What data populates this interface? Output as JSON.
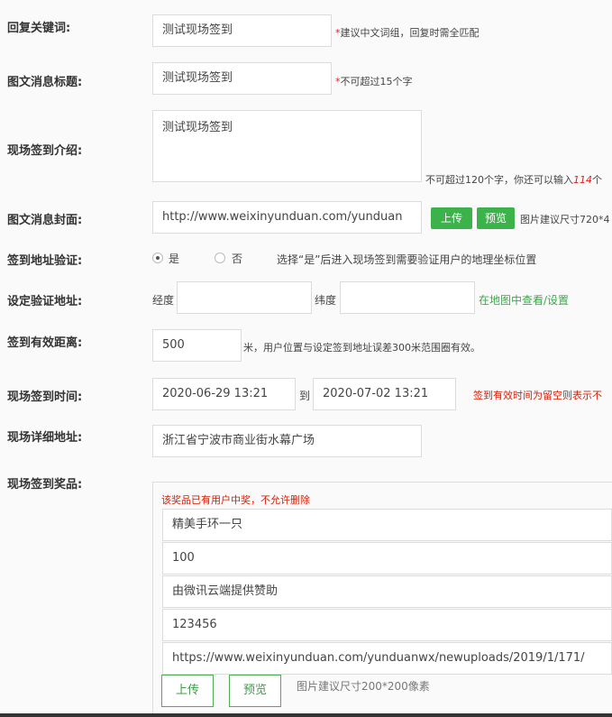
{
  "keyword": {
    "label": "回复关键词:",
    "value": "测试现场签到",
    "req": "*",
    "hint": "建议中文词组，回复时需全匹配"
  },
  "title": {
    "label": "图文消息标题:",
    "value": "测试现场签到",
    "req": "*",
    "hint": "不可超过15个字"
  },
  "intro": {
    "label": "现场签到介绍:",
    "value": "测试现场签到",
    "hint_prefix": "不可超过120个字，你还可以输入",
    "remaining": "114",
    "hint_suffix": "个"
  },
  "cover": {
    "label": "图文消息封面:",
    "value": "http://www.weixinyunduan.com/yunduan",
    "upload": "上传",
    "preview": "预览",
    "hint": "图片建议尺寸720*4"
  },
  "verify": {
    "label": "签到地址验证:",
    "yes": "是",
    "no": "否",
    "hint": "选择“是”后进入现场签到需要验证用户的地理坐标位置"
  },
  "location": {
    "label": "设定验证地址:",
    "lng_label": "经度",
    "lat_label": "纬度",
    "lng": "",
    "lat": "",
    "map_link": "在地图中查看/设置"
  },
  "distance": {
    "label": "签到有效距离:",
    "value": "500",
    "hint": "米，用户位置与设定签到地址误差300米范围圈有效。"
  },
  "time": {
    "label": "现场签到时间:",
    "start": "2020-06-29 13:21",
    "to": "到",
    "end": "2020-07-02 13:21",
    "hint": "签到有效时间为留空则表示不"
  },
  "address": {
    "label": "现场详细地址:",
    "value": "浙江省宁波市商业街水幕广场"
  },
  "prize": {
    "label": "现场签到奖品:",
    "warning": "该奖品已有用户中奖，不允许删除",
    "name": "精美手环一只",
    "count": "100",
    "sponsor": "由微讯云端提供赞助",
    "code": "123456",
    "image_url": "https://www.weixinyunduan.com/yunduanwx/newuploads/2019/1/171/",
    "upload": "上传",
    "preview": "预览",
    "hint": "图片建议尺寸200*200像素"
  }
}
